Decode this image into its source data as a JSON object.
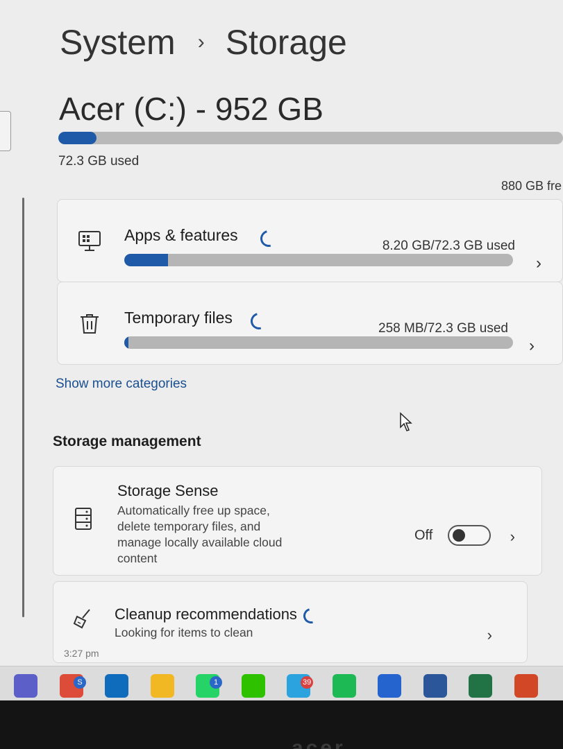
{
  "breadcrumb": {
    "parent": "System",
    "current": "Storage"
  },
  "drive": {
    "title": "Acer (C:) - 952 GB",
    "used_label": "72.3 GB used",
    "free_label": "880 GB fre",
    "used_fraction": 0.076
  },
  "categories": [
    {
      "label": "Apps & features",
      "amount": "8.20 GB/72.3 GB used",
      "icon": "apps-icon",
      "fraction": 0.113
    },
    {
      "label": "Temporary files",
      "amount": "258 MB/72.3 GB used",
      "icon": "trash-icon",
      "fraction": 0.004
    }
  ],
  "show_more": "Show more categories",
  "management": {
    "title": "Storage management",
    "storage_sense": {
      "title": "Storage Sense",
      "description": "Automatically free up space, delete temporary files, and manage locally available cloud content",
      "toggle_state": "Off",
      "icon": "storage-sense-icon"
    },
    "cleanup": {
      "title": "Cleanup recommendations",
      "subtitle": "Looking for items to clean",
      "icon": "broom-icon"
    }
  },
  "taskbar": {
    "clock_fragment": "3:27 pm",
    "apps": [
      {
        "name": "teams-icon",
        "color": "#5b5fc7"
      },
      {
        "name": "chrome-icon",
        "color": "#dd4b39",
        "badge": "S"
      },
      {
        "name": "outlook-icon",
        "color": "#0f6cbd"
      },
      {
        "name": "file-explorer-icon",
        "color": "#f2b824"
      },
      {
        "name": "whatsapp-icon",
        "color": "#25d366",
        "badge": "1"
      },
      {
        "name": "wechat-icon",
        "color": "#2dc100"
      },
      {
        "name": "telegram-icon",
        "color": "#2aa3de",
        "badge": "39"
      },
      {
        "name": "spotify-icon",
        "color": "#1db954"
      },
      {
        "name": "todo-icon",
        "color": "#2564cf"
      },
      {
        "name": "word-icon",
        "color": "#2b579a"
      },
      {
        "name": "excel-icon",
        "color": "#217346"
      },
      {
        "name": "powerpoint-icon",
        "color": "#d24726"
      }
    ]
  },
  "colors": {
    "accent": "#1e5aa8",
    "link": "#1a4f8f"
  }
}
